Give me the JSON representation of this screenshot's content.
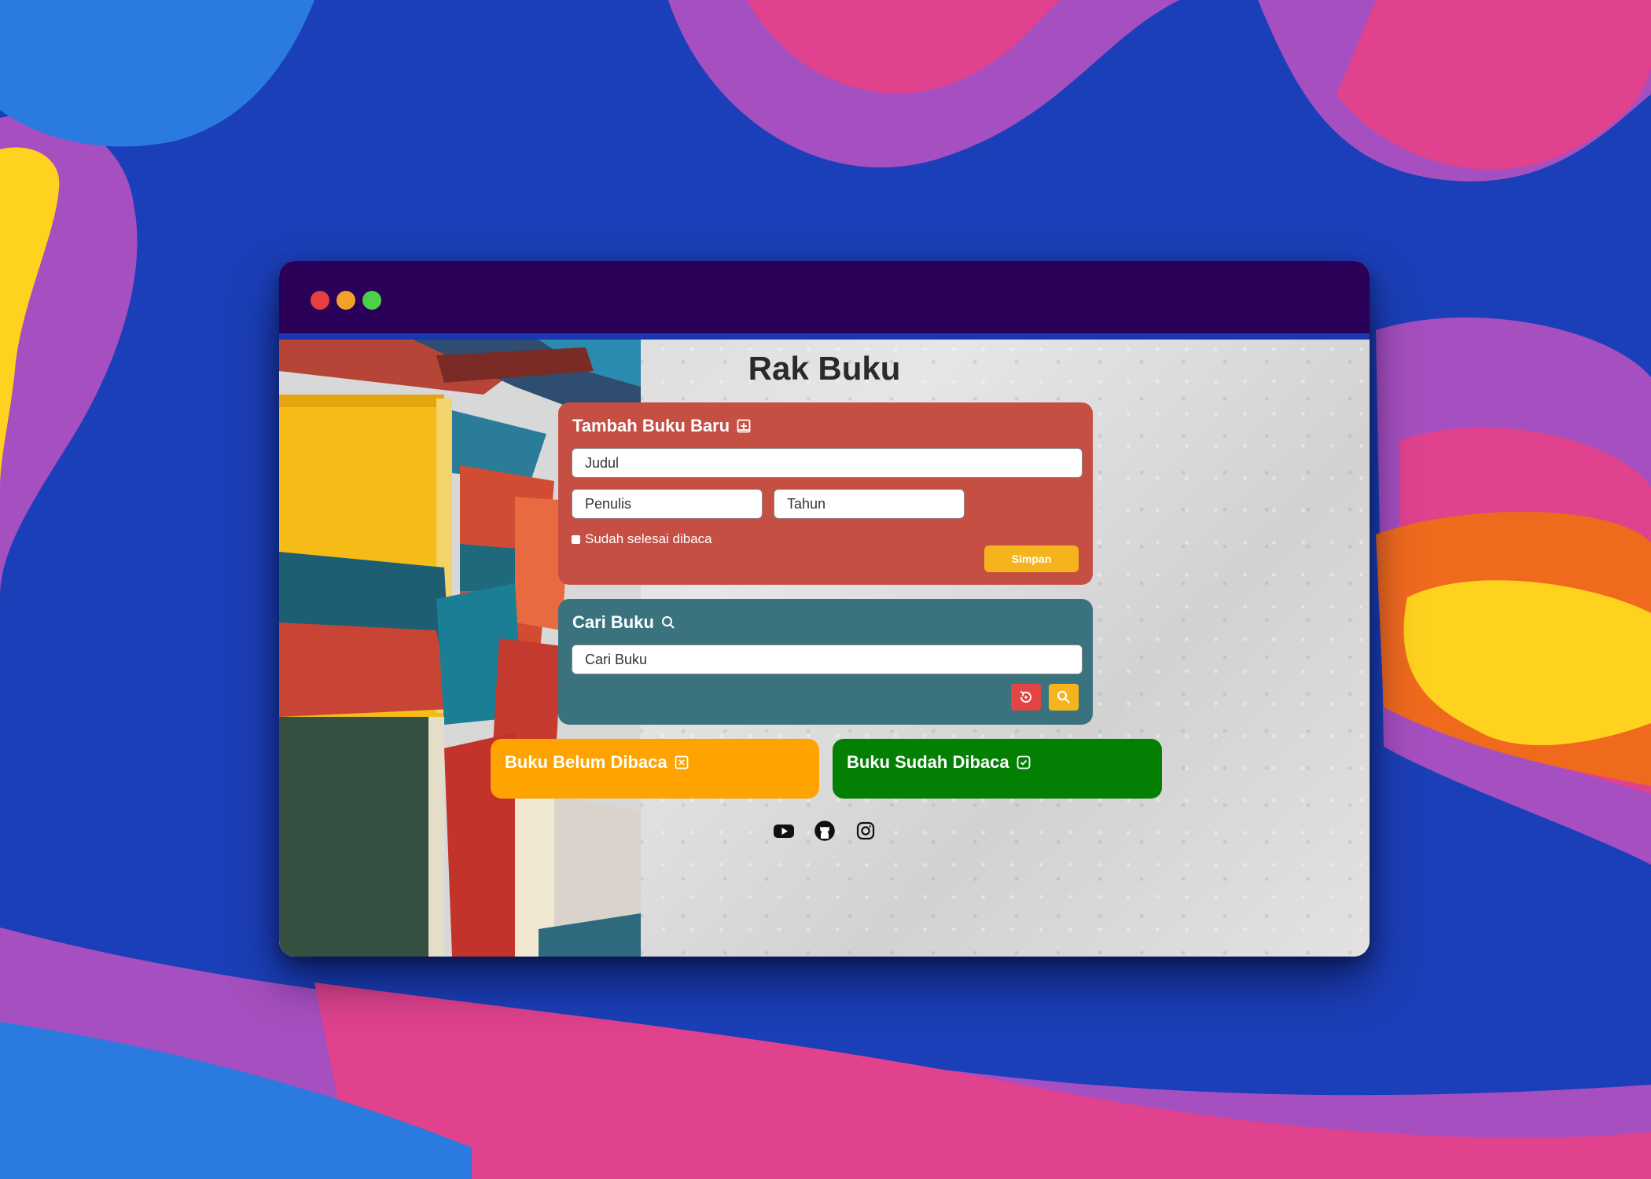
{
  "app": {
    "title": "Rak Buku"
  },
  "add_book": {
    "heading": "Tambah Buku Baru",
    "icon": "book-add-icon",
    "title_placeholder": "Judul",
    "author_placeholder": "Penulis",
    "year_placeholder": "Tahun",
    "finished_label": "Sudah selesai dibaca",
    "save_label": "Simpan",
    "color": "#c64f44"
  },
  "search": {
    "heading": "Cari Buku",
    "icon": "search-icon",
    "placeholder": "Cari Buku",
    "reset_icon": "reset-icon",
    "search_icon": "search-icon",
    "color": "#3a737e"
  },
  "shelves": {
    "unread": {
      "heading": "Buku Belum Dibaca",
      "icon": "x-square-icon",
      "color": "#fea300"
    },
    "read": {
      "heading": "Buku Sudah Dibaca",
      "icon": "check-square-icon",
      "color": "#038003"
    }
  },
  "socials": [
    "youtube-icon",
    "github-icon",
    "instagram-icon"
  ],
  "window": {
    "titlebar_color": "#2b0058",
    "controls": [
      "close",
      "minimize",
      "maximize"
    ]
  }
}
